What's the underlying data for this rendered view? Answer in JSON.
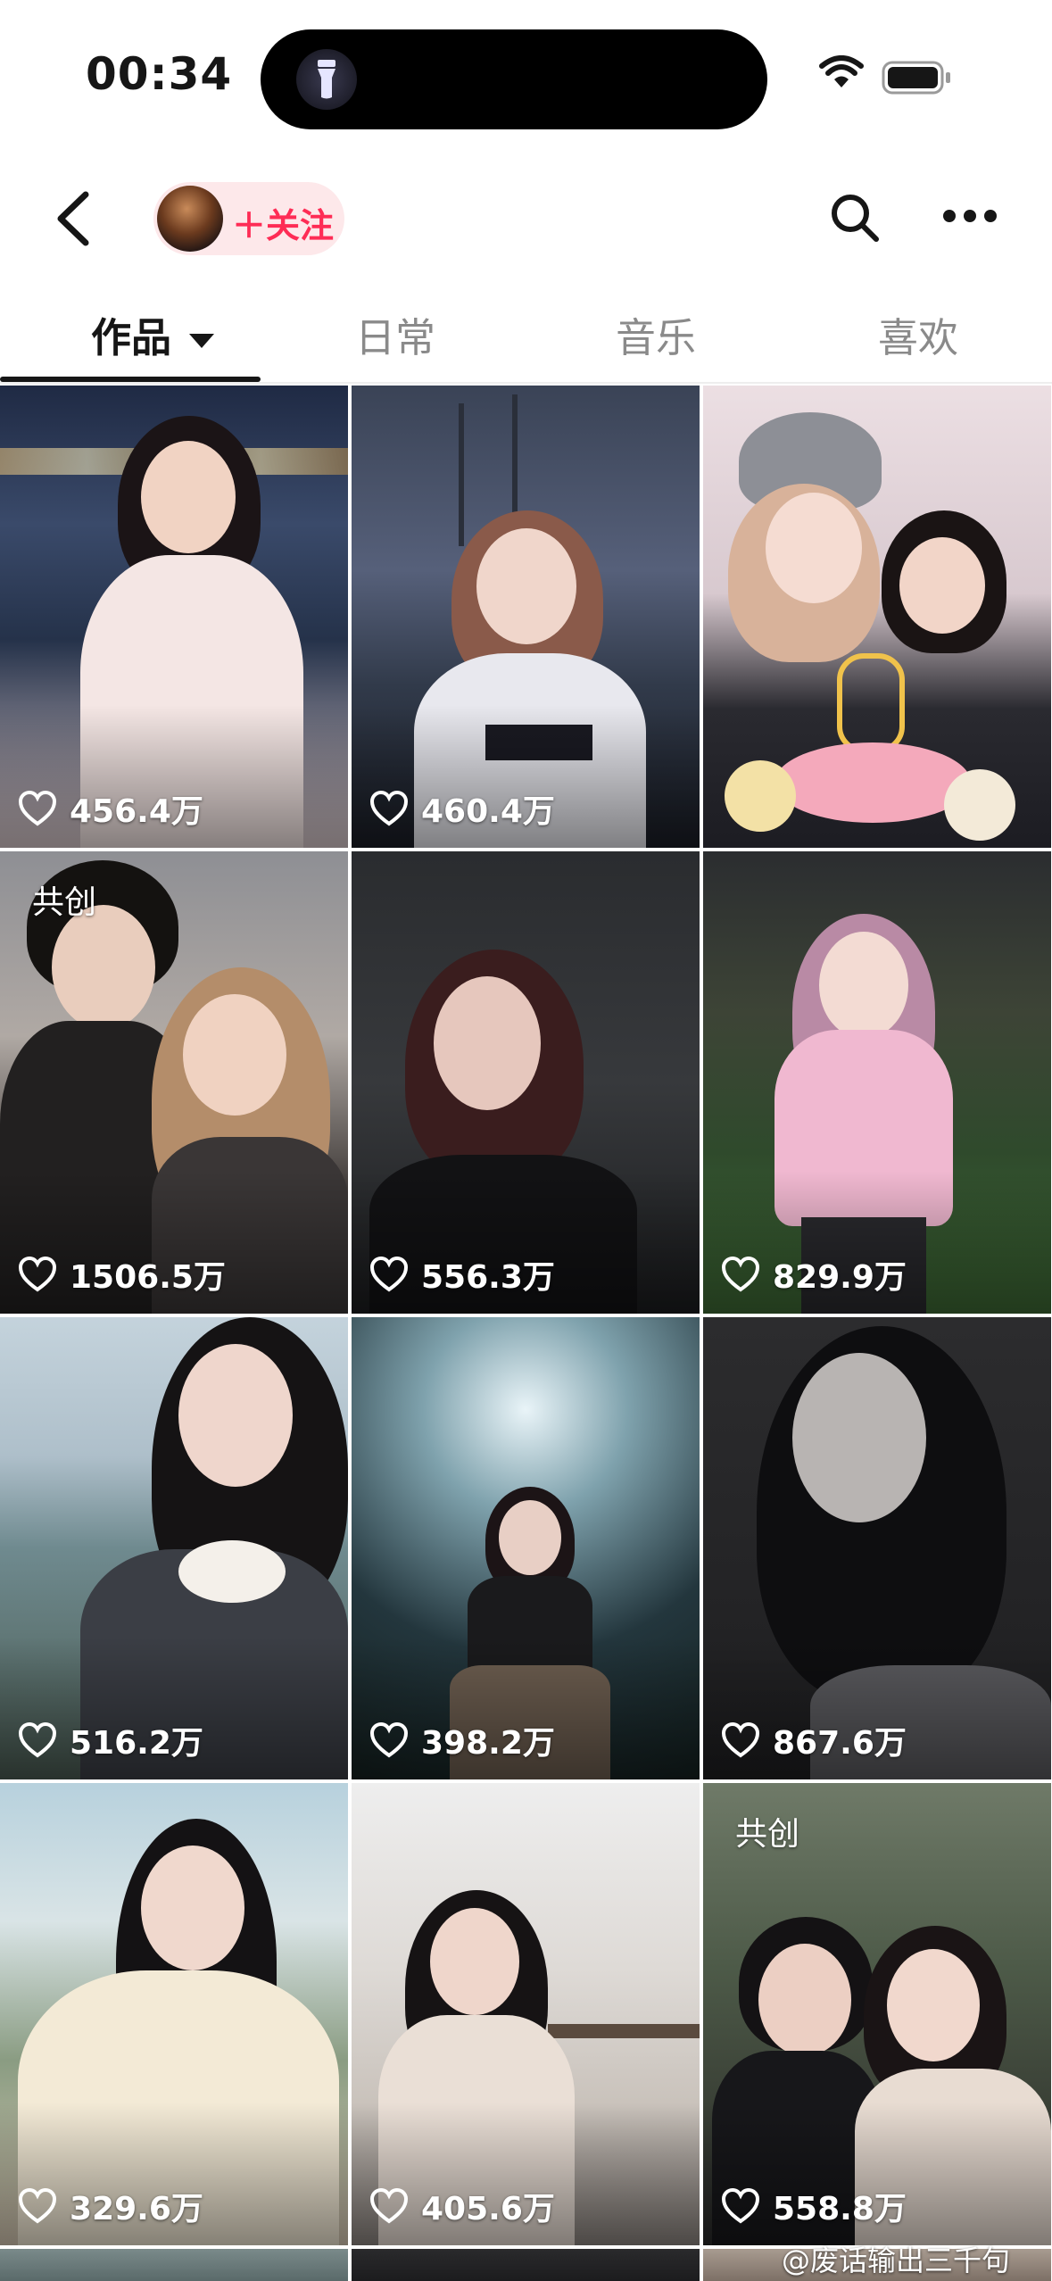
{
  "status_bar": {
    "time": "00:34",
    "island_icon": "flashlight-icon",
    "wifi_icon": "wifi-icon",
    "battery_icon": "battery-icon"
  },
  "nav": {
    "back_icon": "back-chevron-icon",
    "follow_label": "＋关注",
    "search_icon": "search-icon",
    "more_icon": "more-dots-icon"
  },
  "tabs": [
    {
      "label": "作品",
      "active": true
    },
    {
      "label": "日常",
      "active": false
    },
    {
      "label": "音乐",
      "active": false
    },
    {
      "label": "喜欢",
      "active": false
    }
  ],
  "posts": [
    {
      "likes": "456.4万",
      "badge": ""
    },
    {
      "likes": "460.4万",
      "badge": ""
    },
    {
      "likes": "",
      "badge": ""
    },
    {
      "likes": "1506.5万",
      "badge": "共创"
    },
    {
      "likes": "556.3万",
      "badge": ""
    },
    {
      "likes": "829.9万",
      "badge": ""
    },
    {
      "likes": "516.2万",
      "badge": ""
    },
    {
      "likes": "398.2万",
      "badge": ""
    },
    {
      "likes": "867.6万",
      "badge": ""
    },
    {
      "likes": "329.6万",
      "badge": ""
    },
    {
      "likes": "405.6万",
      "badge": ""
    },
    {
      "likes": "558.8万",
      "badge": "共创"
    }
  ],
  "watermark": "@废话输出三千句",
  "colors": {
    "accent": "#fe2c55",
    "follow_bg": "#fde8ea",
    "text": "#161616",
    "muted": "#8a8a8a"
  }
}
